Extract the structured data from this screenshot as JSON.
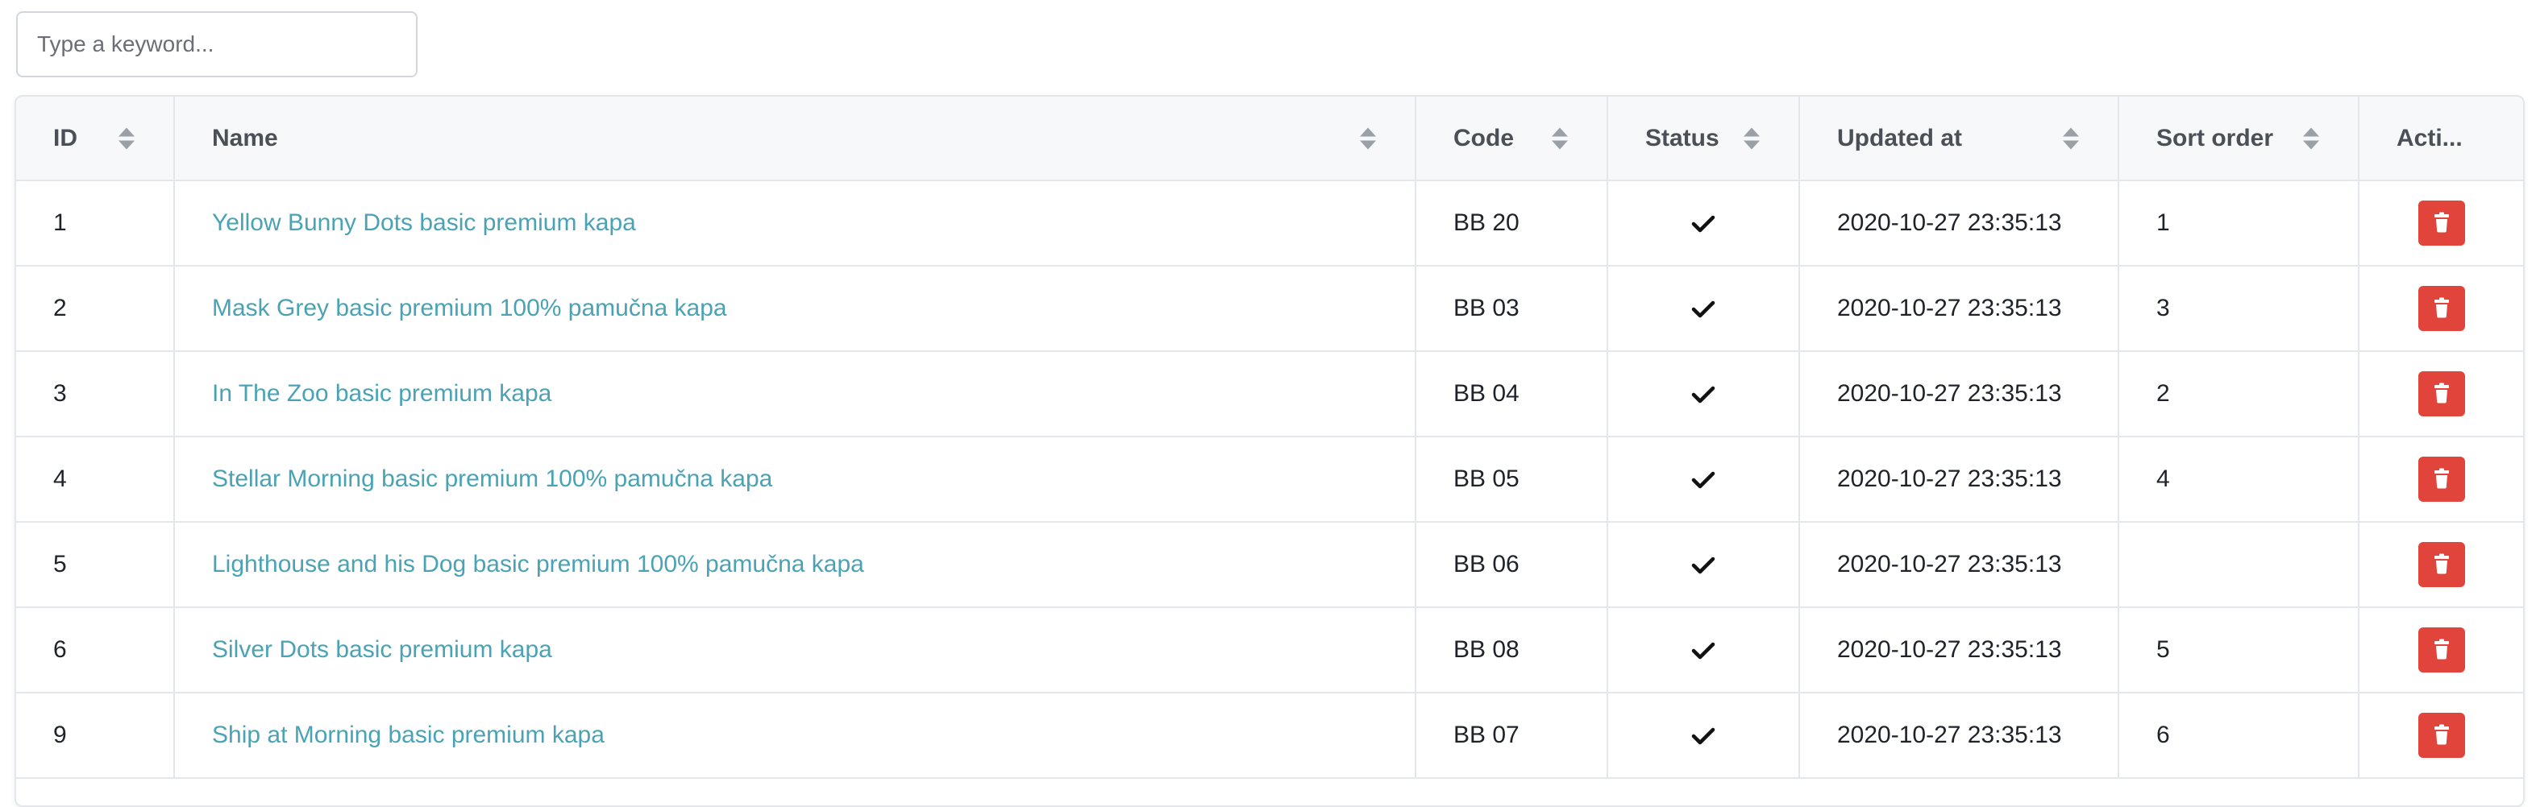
{
  "search": {
    "placeholder": "Type a keyword..."
  },
  "table": {
    "columns": {
      "id": "ID",
      "name": "Name",
      "code": "Code",
      "status": "Status",
      "updated_at": "Updated at",
      "sort_order": "Sort order",
      "actions": "Acti..."
    },
    "rows": [
      {
        "id": "1",
        "name": "Yellow Bunny Dots basic premium kapa",
        "code": "BB 20",
        "status": "active",
        "updated_at": "2020-10-27 23:35:13",
        "sort_order": "1"
      },
      {
        "id": "2",
        "name": "Mask Grey basic premium 100% pamučna kapa",
        "code": "BB 03",
        "status": "active",
        "updated_at": "2020-10-27 23:35:13",
        "sort_order": "3"
      },
      {
        "id": "3",
        "name": "In The Zoo basic premium kapa",
        "code": "BB 04",
        "status": "active",
        "updated_at": "2020-10-27 23:35:13",
        "sort_order": "2"
      },
      {
        "id": "4",
        "name": "Stellar Morning basic premium 100% pamučna kapa",
        "code": "BB 05",
        "status": "active",
        "updated_at": "2020-10-27 23:35:13",
        "sort_order": "4"
      },
      {
        "id": "5",
        "name": "Lighthouse and his Dog basic premium 100% pamučna kapa",
        "code": "BB 06",
        "status": "active",
        "updated_at": "2020-10-27 23:35:13",
        "sort_order": ""
      },
      {
        "id": "6",
        "name": "Silver Dots basic premium kapa",
        "code": "BB 08",
        "status": "active",
        "updated_at": "2020-10-27 23:35:13",
        "sort_order": "5"
      },
      {
        "id": "9",
        "name": "Ship at Morning basic premium kapa",
        "code": "BB 07",
        "status": "active",
        "updated_at": "2020-10-27 23:35:13",
        "sort_order": "6"
      }
    ]
  },
  "icons": {
    "status": "check-icon",
    "delete": "trash-icon",
    "sort": "sort-icon"
  },
  "colors": {
    "link": "#4aa3b5",
    "danger": "#e0443a",
    "header_bg": "#f7f8f9"
  }
}
